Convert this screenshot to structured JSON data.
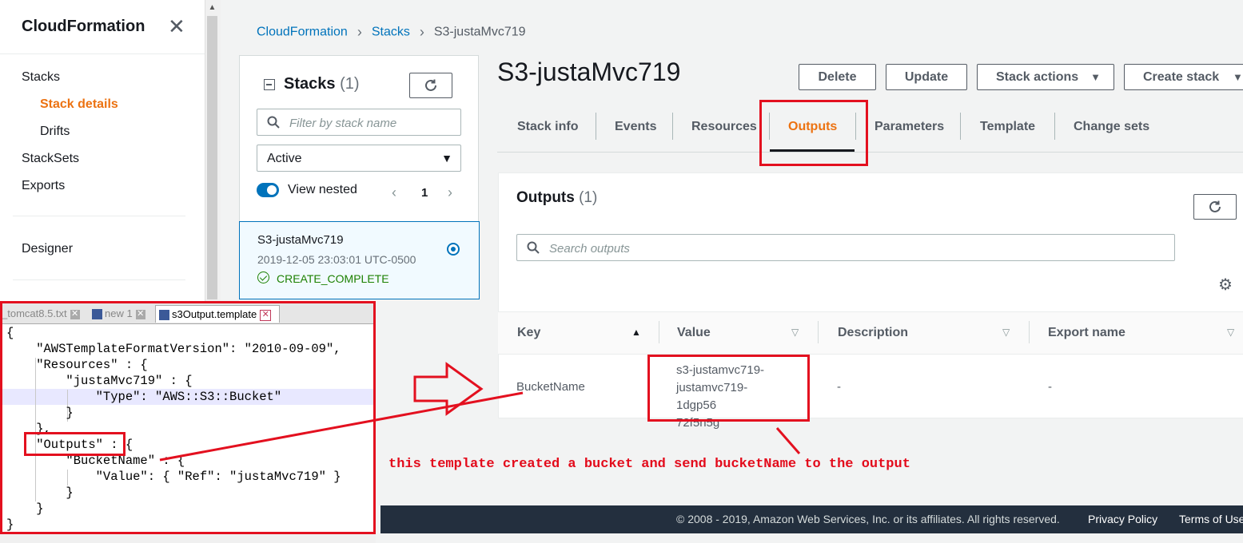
{
  "nav": {
    "title": "CloudFormation",
    "close_glyph": "✕",
    "items": [
      {
        "label": "Stacks",
        "active": false
      },
      {
        "label": "Stack details",
        "active": true
      },
      {
        "label": "Drifts",
        "active": false
      },
      {
        "label": "StackSets",
        "active": false
      },
      {
        "label": "Exports",
        "active": false
      },
      {
        "label": "Designer",
        "active": false
      }
    ]
  },
  "breadcrumb": {
    "items": [
      "CloudFormation",
      "Stacks",
      "S3-justaMvc719"
    ],
    "separator": "›"
  },
  "stacks_panel": {
    "title": "Stacks",
    "count": "(1)",
    "filter_placeholder": "Filter by stack name",
    "status_filter": "Active",
    "view_nested_label": "View nested",
    "page": "1",
    "stack": {
      "name": "S3-justaMvc719",
      "created": "2019-12-05 23:03:01 UTC-0500",
      "status": "CREATE_COMPLETE"
    }
  },
  "header": {
    "stack_name": "S3-justaMvc719",
    "buttons": {
      "delete": "Delete",
      "update": "Update",
      "stack_actions": "Stack actions",
      "create_stack": "Create stack"
    }
  },
  "tabs": [
    "Stack info",
    "Events",
    "Resources",
    "Outputs",
    "Parameters",
    "Template",
    "Change sets"
  ],
  "active_tab": "Outputs",
  "outputs": {
    "title": "Outputs",
    "count": "(1)",
    "search_placeholder": "Search outputs",
    "columns": [
      "Key",
      "Value",
      "Description",
      "Export name"
    ],
    "rows": [
      {
        "key": "BucketName",
        "value_lines": [
          "s3-justamvc719-",
          "justamvc719-1dgp56",
          "72f5n5g"
        ],
        "description": "-",
        "export_name": "-"
      }
    ]
  },
  "footer": {
    "copyright": "© 2008 - 2019, Amazon Web Services, Inc. or its affiliates. All rights reserved.",
    "privacy": "Privacy Policy",
    "terms": "Terms of Use"
  },
  "editor": {
    "tabs": [
      "_tomcat8.5.txt",
      "new 1",
      "s3Output.template"
    ],
    "active_tab": "s3Output.template",
    "lines": [
      "{",
      "    \"AWSTemplateFormatVersion\": \"2010-09-09\",",
      "    \"Resources\" : {",
      "        \"justaMvc719\" : {",
      "            \"Type\": \"AWS::S3::Bucket\"",
      "        }",
      "    },",
      "    \"Outputs\" : {",
      "        \"BucketName\" : {",
      "            \"Value\": { \"Ref\": \"justaMvc719\" }",
      "        }",
      "    }",
      "}"
    ]
  },
  "annotation": {
    "text": "this template created a bucket and send bucketName to the output",
    "color": "#e30b1b"
  },
  "colors": {
    "accent_orange": "#ec7211",
    "link_blue": "#0073bb",
    "success_green": "#1d8102",
    "footer_bg": "#232f3e"
  }
}
